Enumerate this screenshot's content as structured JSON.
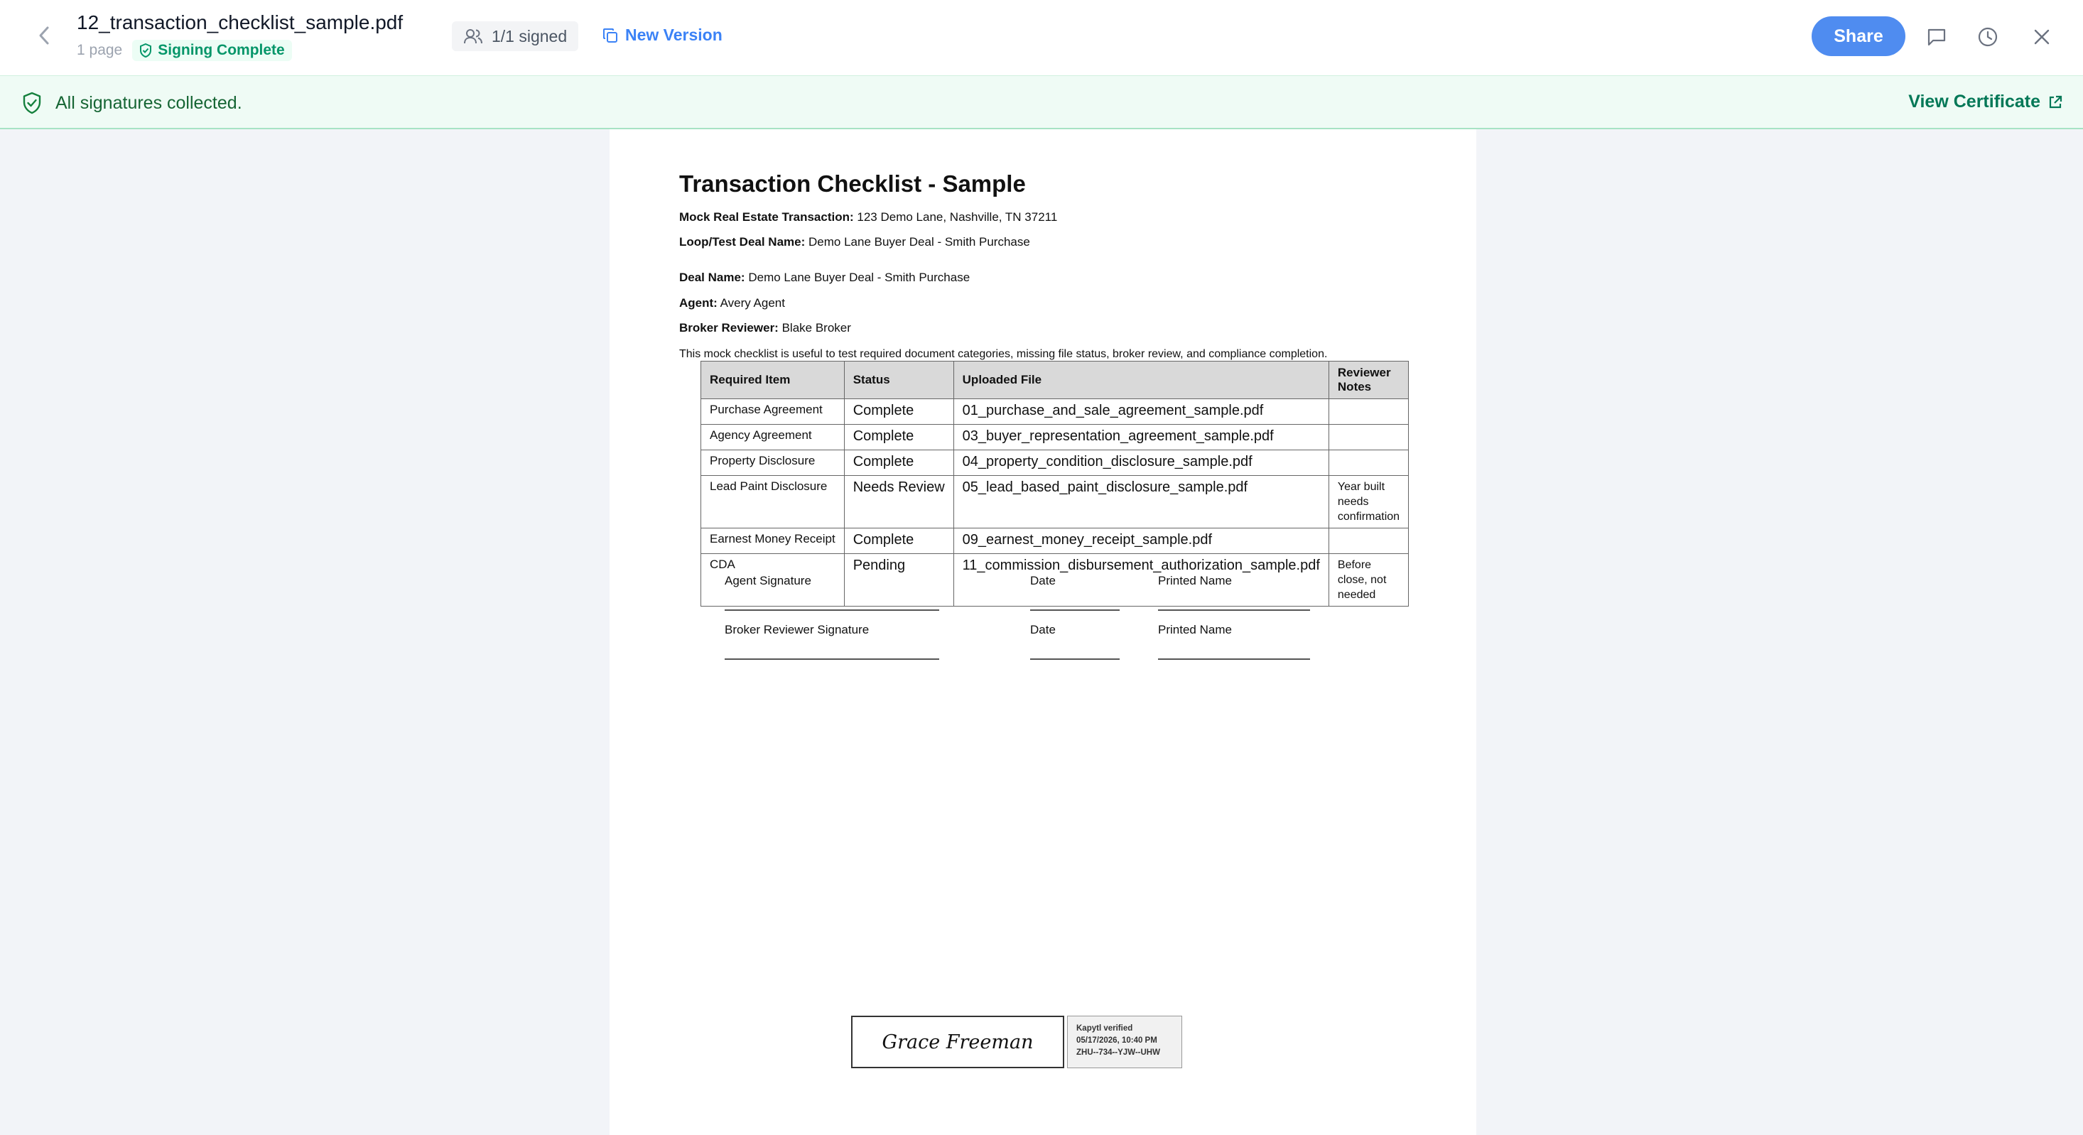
{
  "header": {
    "title": "12_transaction_checklist_sample.pdf",
    "page_count": "1 page",
    "status_badge": "Signing Complete",
    "signed_count": "1/1 signed",
    "new_version_label": "New Version",
    "share_label": "Share"
  },
  "banner": {
    "message": "All signatures collected.",
    "certificate_link": "View Certificate"
  },
  "document": {
    "title": "Transaction Checklist - Sample",
    "fields": [
      {
        "label": "Mock Real Estate Transaction:",
        "value": "123 Demo Lane, Nashville, TN 37211"
      },
      {
        "label": "Loop/Test Deal Name:",
        "value": "Demo Lane Buyer Deal - Smith Purchase"
      },
      {
        "label": "Deal Name:",
        "value": "Demo Lane Buyer Deal - Smith Purchase"
      },
      {
        "label": "Agent:",
        "value": "Avery Agent"
      },
      {
        "label": "Broker Reviewer:",
        "value": "Blake Broker"
      }
    ],
    "intro": "This mock checklist is useful to test required document categories, missing file status, broker review, and compliance completion.",
    "table": {
      "headers": [
        "Required Item",
        "Status",
        "Uploaded File",
        "Reviewer Notes"
      ],
      "rows": [
        [
          "Purchase Agreement",
          "Complete",
          "01_purchase_and_sale_agreement_sample.pdf",
          ""
        ],
        [
          "Agency Agreement",
          "Complete",
          "03_buyer_representation_agreement_sample.pdf",
          ""
        ],
        [
          "Property Disclosure",
          "Complete",
          "04_property_condition_disclosure_sample.pdf",
          ""
        ],
        [
          "Lead Paint Disclosure",
          "Needs Review",
          "05_lead_based_paint_disclosure_sample.pdf",
          "Year built needs confirmation"
        ],
        [
          "Earnest Money Receipt",
          "Complete",
          "09_earnest_money_receipt_sample.pdf",
          ""
        ],
        [
          "CDA",
          "Pending",
          "11_commission_disbursement_authorization_sample.pdf",
          "Before close, not needed"
        ]
      ]
    },
    "signature_labels": {
      "agent_signature": "Agent Signature",
      "broker_signature": "Broker Reviewer Signature",
      "date": "Date",
      "printed_name": "Printed Name"
    },
    "signature": {
      "name": "Grace Freeman",
      "verified_line1": "Kapytl verified",
      "verified_line2": "05/17/2026, 10:40 PM",
      "verified_line3": "ZHU--734--YJW--UHW"
    }
  },
  "colors": {
    "accent": "#4f8cf0",
    "success": "#059669",
    "banner_bg": "#effbf5"
  }
}
